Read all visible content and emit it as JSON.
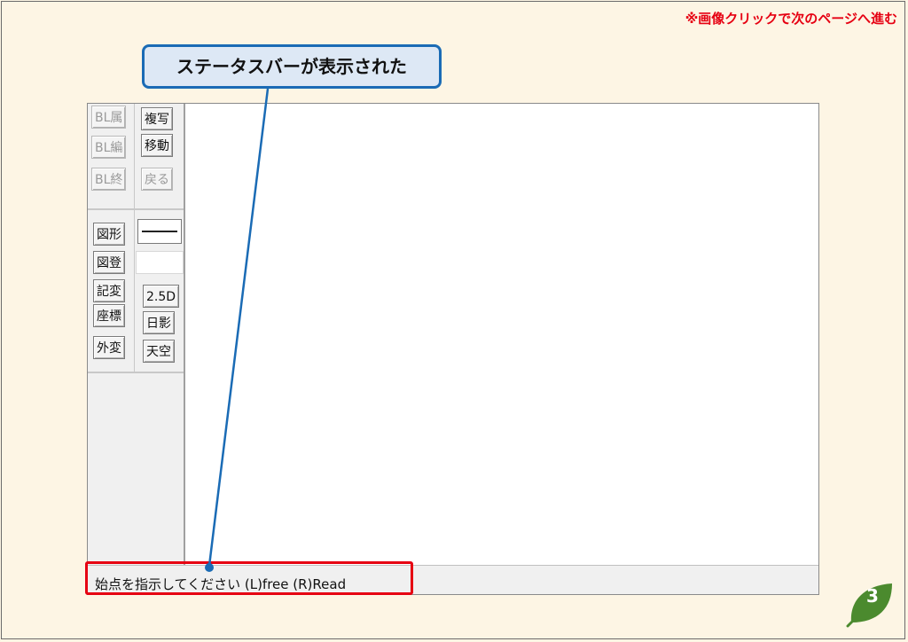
{
  "header": {
    "next_page_note": "※画像クリックで次のページへ進む"
  },
  "callout": {
    "text": "ステータスバーが表示された"
  },
  "toolbar": {
    "buttons": [
      {
        "label": "BL属",
        "enabled": false
      },
      {
        "label": "複写",
        "enabled": true
      },
      {
        "label": "BL編",
        "enabled": false
      },
      {
        "label": "移動",
        "enabled": true
      },
      {
        "label": "BL終",
        "enabled": false
      },
      {
        "label": "戻る",
        "enabled": false
      },
      {
        "label": "図形",
        "enabled": true
      },
      {
        "label": "図登",
        "enabled": true
      },
      {
        "label": "記変",
        "enabled": true
      },
      {
        "label": "2.5D",
        "enabled": true
      },
      {
        "label": "座標",
        "enabled": true
      },
      {
        "label": "日影",
        "enabled": true
      },
      {
        "label": "外変",
        "enabled": true
      },
      {
        "label": "天空",
        "enabled": true
      }
    ]
  },
  "status_bar": {
    "text": "始点を指示してください (L)free (R)Read"
  },
  "page": {
    "number": "3"
  },
  "colors": {
    "background": "#fdf5e4",
    "accent_red": "#e60012",
    "callout_border": "#1a6bb5",
    "callout_fill": "#dde8f5",
    "badge_green": "#4b8a2e"
  }
}
